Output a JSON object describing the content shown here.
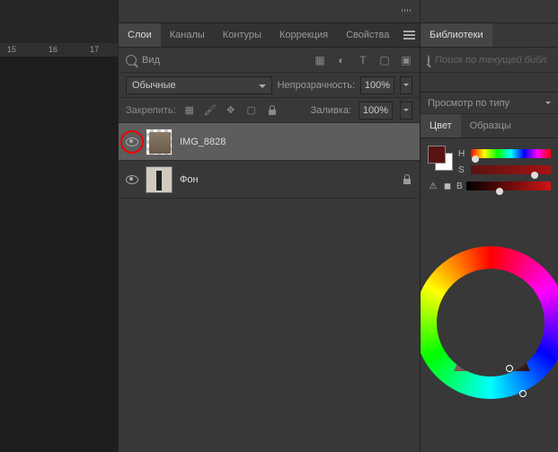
{
  "ruler": {
    "m15": "15",
    "m16": "16",
    "m17": "17"
  },
  "tabs": {
    "layers": "Слои",
    "channels": "Каналы",
    "paths": "Контуры",
    "adjustments": "Коррекция",
    "properties": "Свойства"
  },
  "filter": {
    "kind": "Вид"
  },
  "blend": {
    "mode": "Обычные",
    "opacity_label": "Непрозрачность:",
    "opacity_value": "100%"
  },
  "lock": {
    "label": "Закрепить:",
    "fill_label": "Заливка:",
    "fill_value": "100%"
  },
  "layers": [
    {
      "name": "IMG_8828",
      "visible": true,
      "selected": true,
      "locked": false
    },
    {
      "name": "Фон",
      "visible": true,
      "selected": false,
      "locked": true
    }
  ],
  "right": {
    "libraries": "Библиотеки",
    "search_placeholder": "Поиск по текущей библ",
    "view_by_type": "Просмотр по типу",
    "color_tab": "Цвет",
    "swatches_tab": "Образцы",
    "h": "H",
    "s": "S",
    "b": "B",
    "fg_color": "#5a1212",
    "bg_color": "#ffffff"
  }
}
